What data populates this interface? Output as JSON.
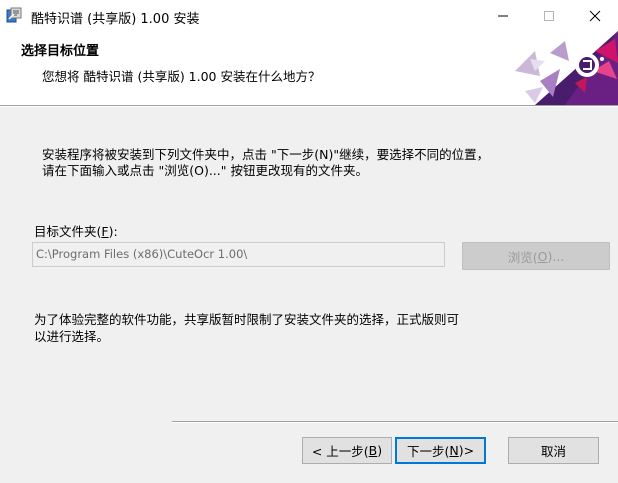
{
  "window": {
    "title": "酷特识谱 (共享版) 1.00 安装",
    "minimize_icon": "minimize-icon",
    "maximize_icon": "maximize-icon",
    "close_icon": "close-icon"
  },
  "header": {
    "title": "选择目标位置",
    "subtitle": "您想将 酷特识谱 (共享版) 1.00 安装在什么地方？"
  },
  "intro": {
    "line1": "安装程序将被安装到下列文件夹中，点击 \"下一步(N)\"继续，要选择不同的位置，",
    "line2": "请在下面输入或点击 \"浏览(O)...\" 按钮更改现有的文件夹。"
  },
  "folder": {
    "label_prefix": "目标文件夹(",
    "label_key": "F",
    "label_suffix": "):",
    "path": "C:\\Program Files (x86)\\CuteOcr 1.00\\",
    "browse_prefix": "浏览(",
    "browse_key": "O",
    "browse_suffix": ")..."
  },
  "note": {
    "line1": "为了体验完整的软件功能，共享版暂时限制了安装文件夹的选择，正式版则可",
    "line2": "以进行选择。"
  },
  "buttons": {
    "back_prefix": "< 上一步(",
    "back_key": "B",
    "back_suffix": ")",
    "next_prefix": "下一步(",
    "next_key": "N",
    "next_suffix": ")>",
    "cancel": "取消"
  },
  "colors": {
    "accent": "#0078d7",
    "logo_purple": "#5a1f7a",
    "logo_magenta": "#c0145a"
  }
}
